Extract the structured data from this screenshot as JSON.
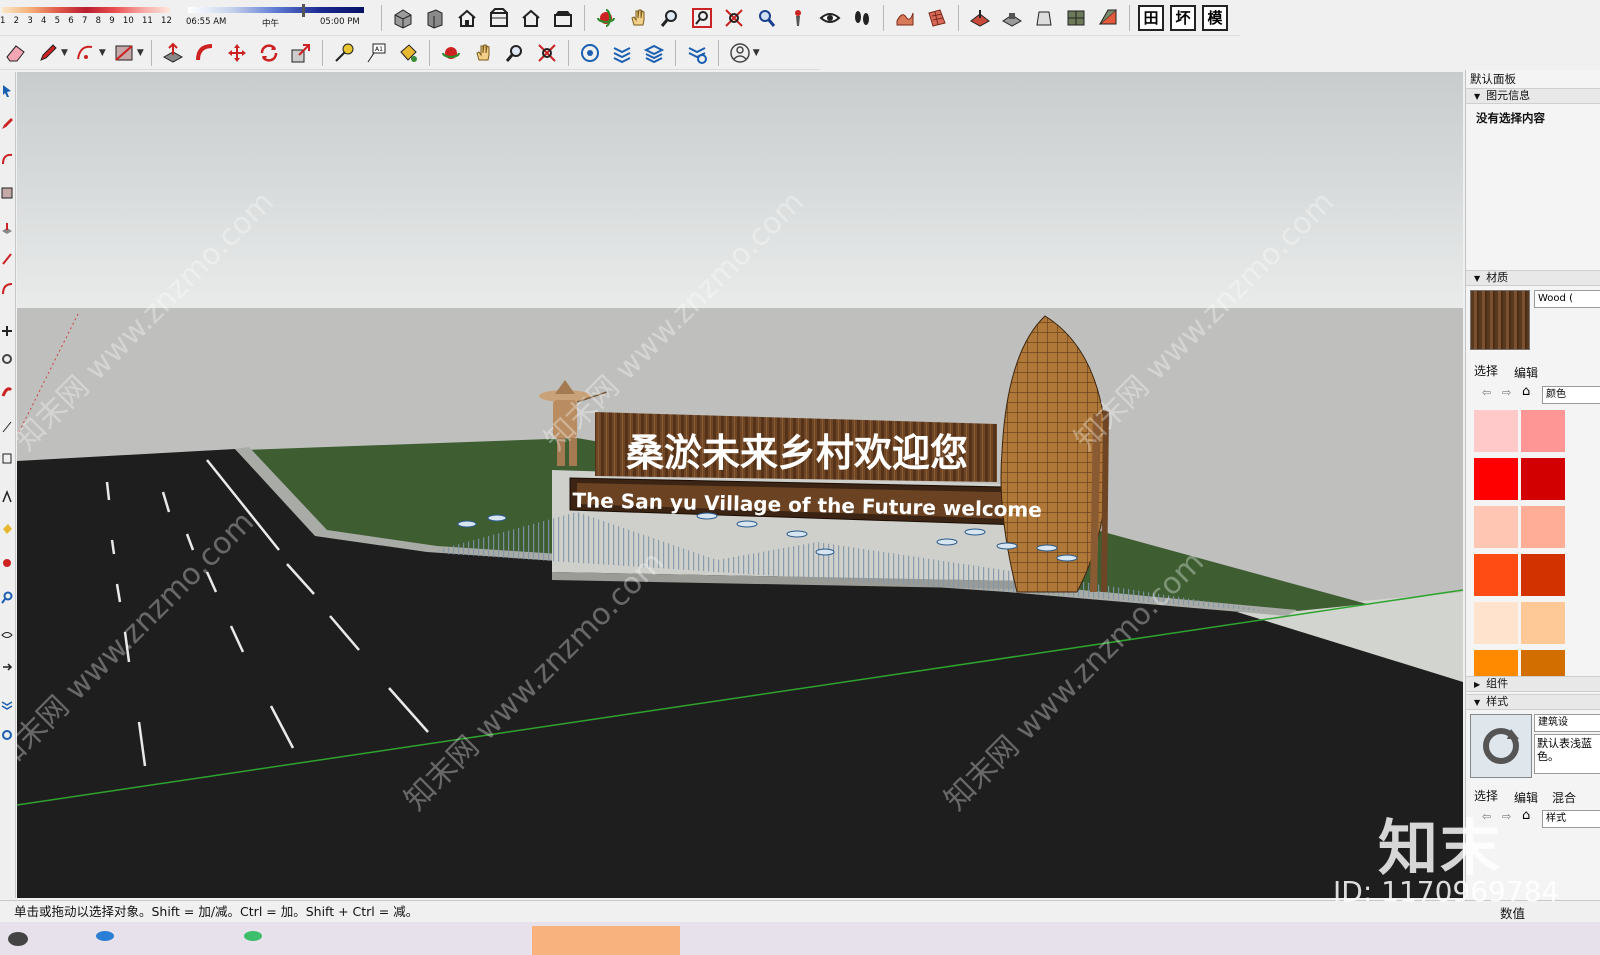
{
  "shadow_settings": {
    "months": [
      "1",
      "2",
      "3",
      "4",
      "5",
      "6",
      "7",
      "8",
      "9",
      "10",
      "11",
      "12"
    ],
    "time_start": "06:55 AM",
    "time_mid": "中午",
    "time_end": "05:00 PM"
  },
  "toolbar_row1": {
    "icons": [
      "standard-views-iso-icon",
      "views-top-icon",
      "views-front-icon",
      "views-right-icon",
      "views-back-icon",
      "views-left-icon",
      "orbit-icon",
      "pan-icon",
      "zoom-icon",
      "zoom-window-icon",
      "zoom-extents-icon",
      "previous-view-icon",
      "position-camera-icon",
      "look-around-icon",
      "walk-icon",
      "sandbox-from-contours-icon",
      "sandbox-from-scratch-icon",
      "smoove-icon",
      "stamp-icon",
      "drape-icon",
      "add-detail-icon",
      "flip-edge-icon"
    ],
    "cjk_buttons": [
      "田",
      "坏",
      "模"
    ]
  },
  "toolbar_row2": {
    "icons": [
      "eraser-icon",
      "pencil-icon",
      "arc-icon",
      "rectangle-icon",
      "push-pull-icon",
      "follow-me-icon",
      "move-icon",
      "rotate-icon",
      "scale-icon",
      "tape-measure-icon",
      "text-icon",
      "paint-bucket-icon",
      "orbit-icon",
      "pan-icon",
      "zoom-icon",
      "zoom-extents-icon",
      "warehouse-icon",
      "extension-warehouse-icon",
      "layout-icon",
      "extension-manager-icon",
      "account-icon"
    ]
  },
  "viewport": {
    "sign_cn": "桑淤未来乡村欢迎您",
    "sign_en": "The San yu Village of the Future welcome",
    "watermark_text": "知末网 www.znzmo.com"
  },
  "right_panel": {
    "tray_title": "默认面板",
    "entity_info": {
      "title": "图元信息",
      "empty_text": "没有选择内容"
    },
    "materials": {
      "title": "材质",
      "material_name": "Wood (",
      "tab_select": "选择",
      "tab_edit": "编辑",
      "library": "颜色",
      "swatches": [
        "#ffc9c9",
        "#ff9696",
        "#ff0000",
        "#d20000",
        "#ffc6b4",
        "#ffad96",
        "#ff4b14",
        "#d23200",
        "#ffe3cc",
        "#ffc896",
        "#ff8a00",
        "#d26e00"
      ]
    },
    "components": {
      "title": "组件"
    },
    "styles": {
      "title": "样式",
      "style_name": "建筑设",
      "style_desc": "默认表浅蓝色。",
      "tab_select": "选择",
      "tab_edit": "编辑",
      "tab_mix": "混合",
      "library": "样式"
    }
  },
  "status_bar": {
    "hint": "单击或拖动以选择对象。Shift = 加/减。Ctrl = 加。Shift + Ctrl = 减。",
    "measurement_label": "数值"
  },
  "watermark": {
    "logo": "知末",
    "id": "ID: 1170969784"
  },
  "colors": {
    "sky": "#d9dcdc",
    "ground_far": "#bfc0bd",
    "road": "#1e1e1e",
    "grass": "#3e5e32",
    "wood": "#6b4322",
    "green_axis": "#2ea42e"
  }
}
